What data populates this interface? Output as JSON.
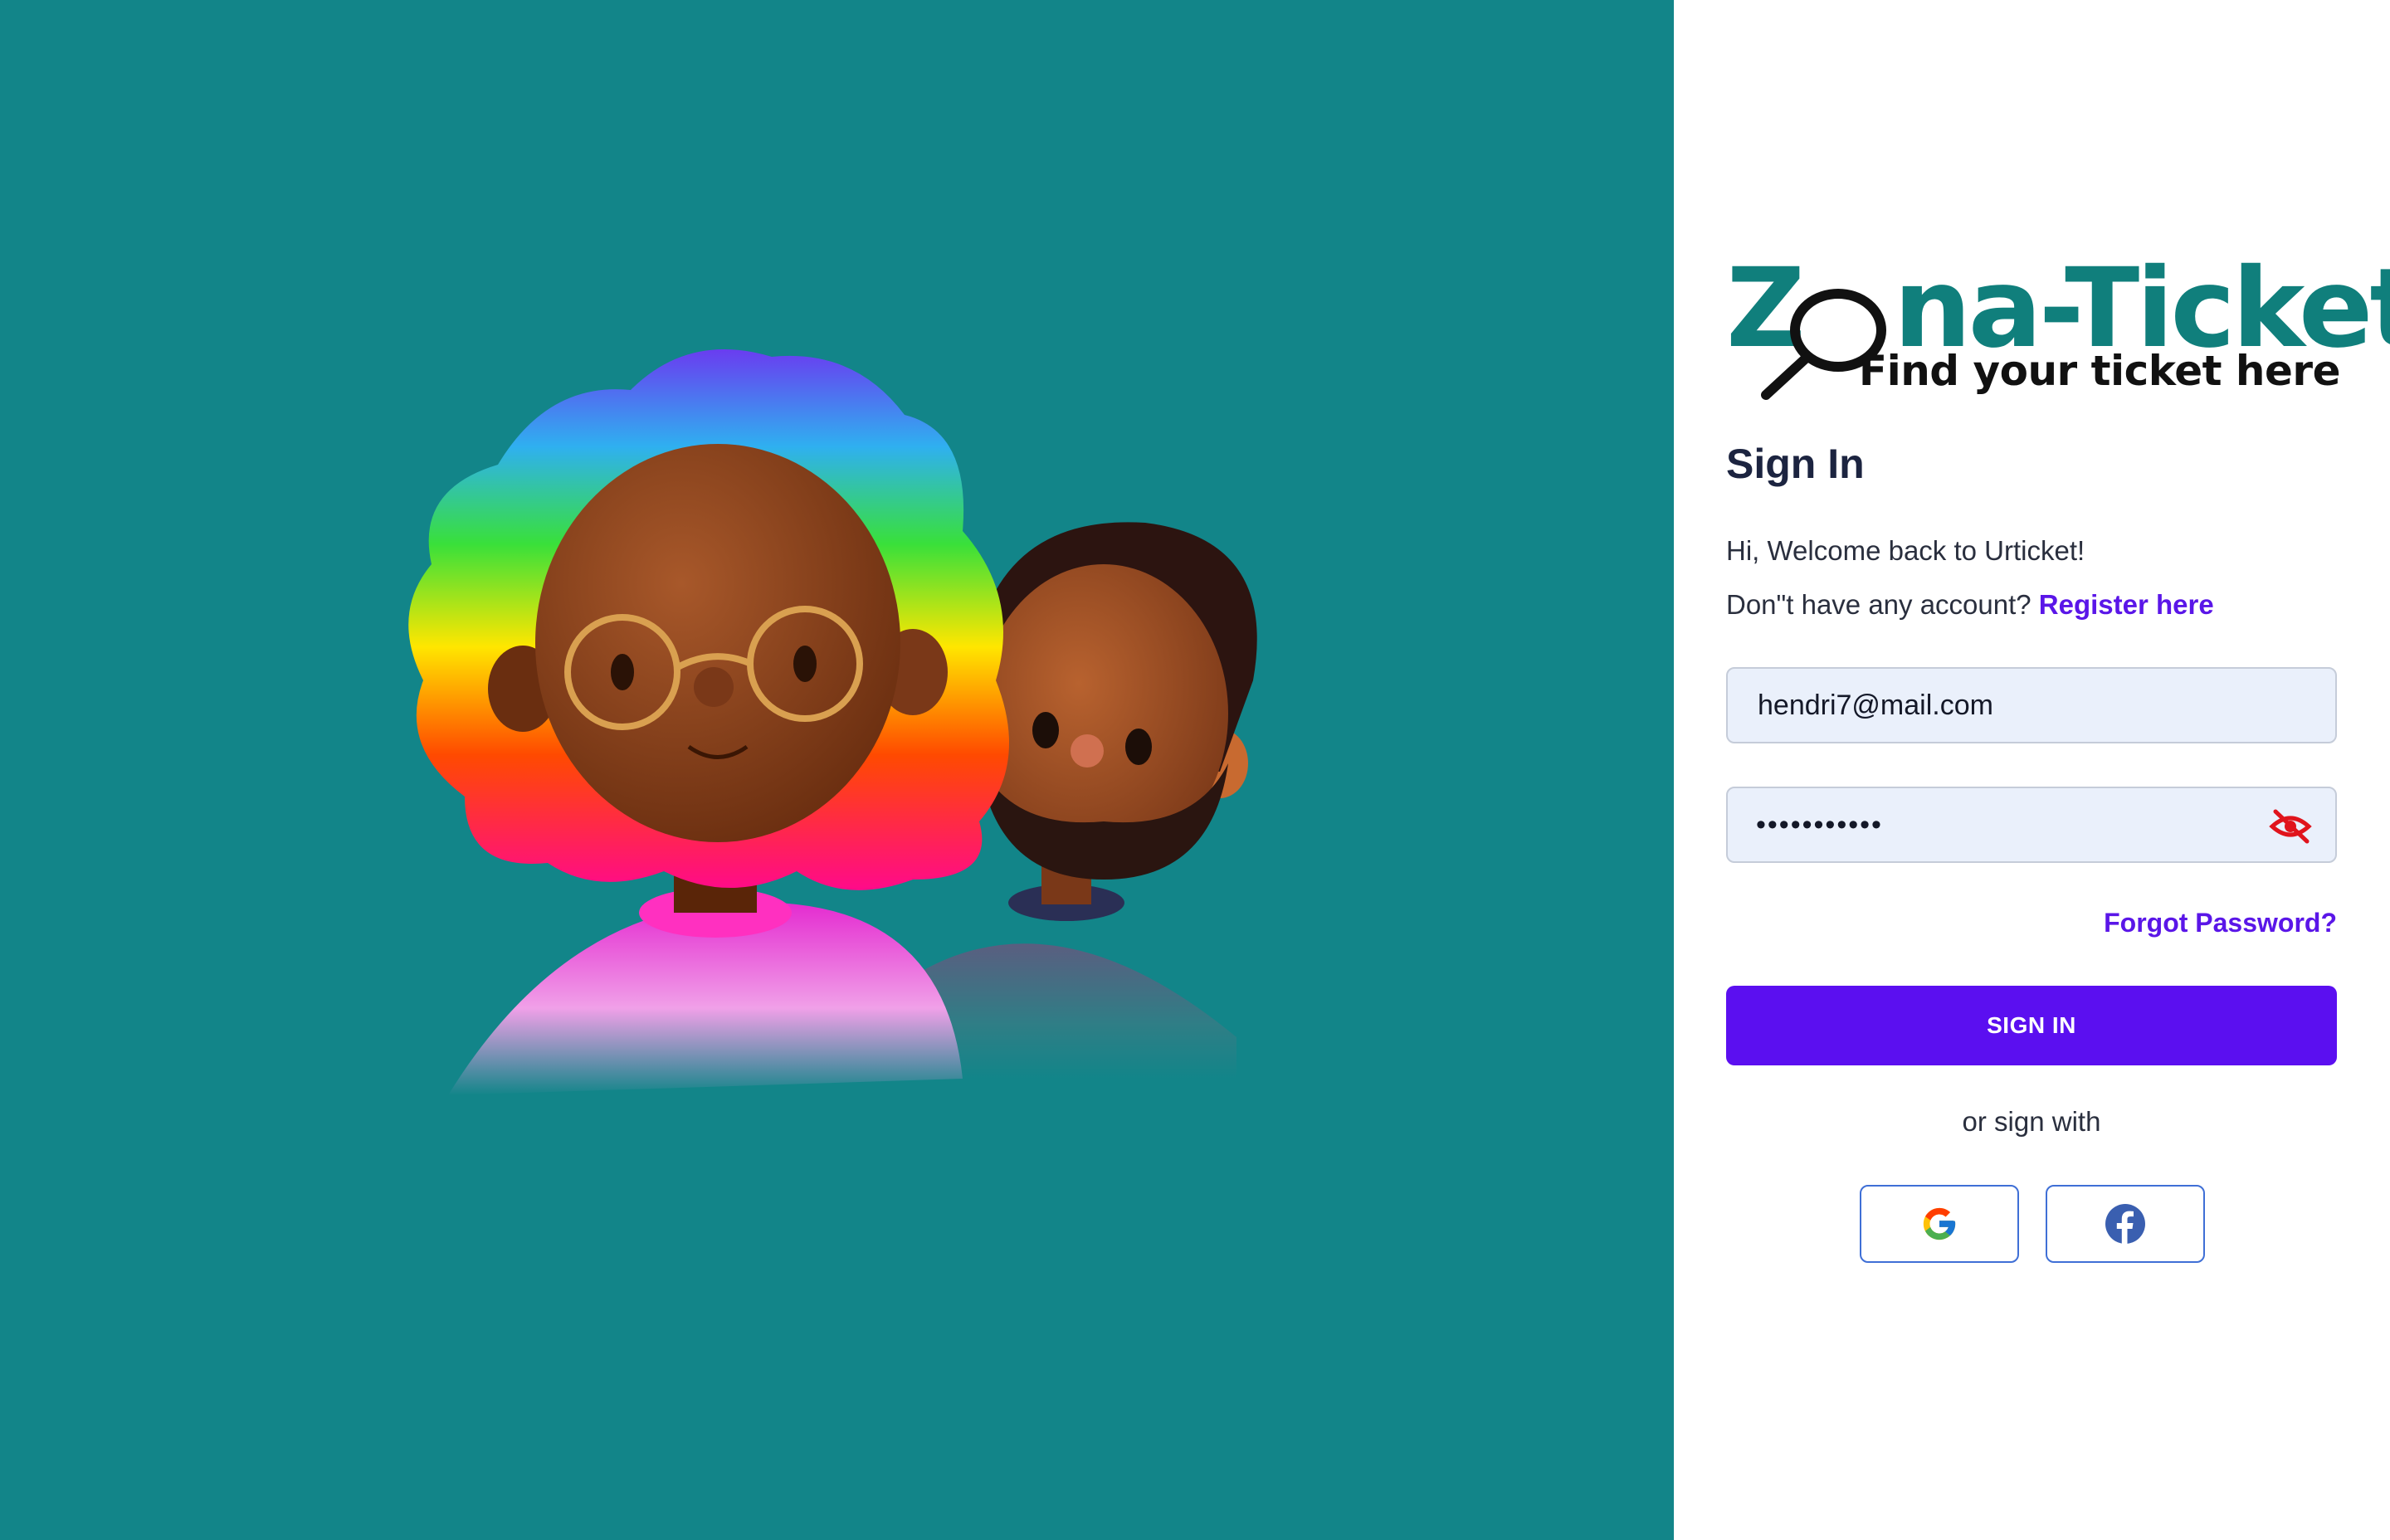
{
  "logo": {
    "title_prefix": "Z",
    "title_suffix": "na-Ticket",
    "tagline": "Find your ticket here"
  },
  "signin": {
    "title": "Sign In",
    "welcome": "Hi, Welcome back to Urticket!",
    "no_account": "Don\"t have any account?",
    "register_link": "Register here",
    "email_value": "hendri7@mail.com",
    "password_mask": "•••••••••••",
    "forgot": "Forgot Password?",
    "submit": "SIGN IN",
    "or_sign_with": "or sign with"
  },
  "icons": {
    "password_toggle": "eye-off-icon",
    "google": "google-icon",
    "facebook": "facebook-icon"
  },
  "colors": {
    "hero_bg": "#128589",
    "brand_teal": "#107f7c",
    "accent": "#5b0ff0",
    "link": "#5a16e8",
    "input_bg": "#eaf0fb",
    "eye_icon": "#e0141c",
    "facebook_blue": "#3a5fb0"
  }
}
